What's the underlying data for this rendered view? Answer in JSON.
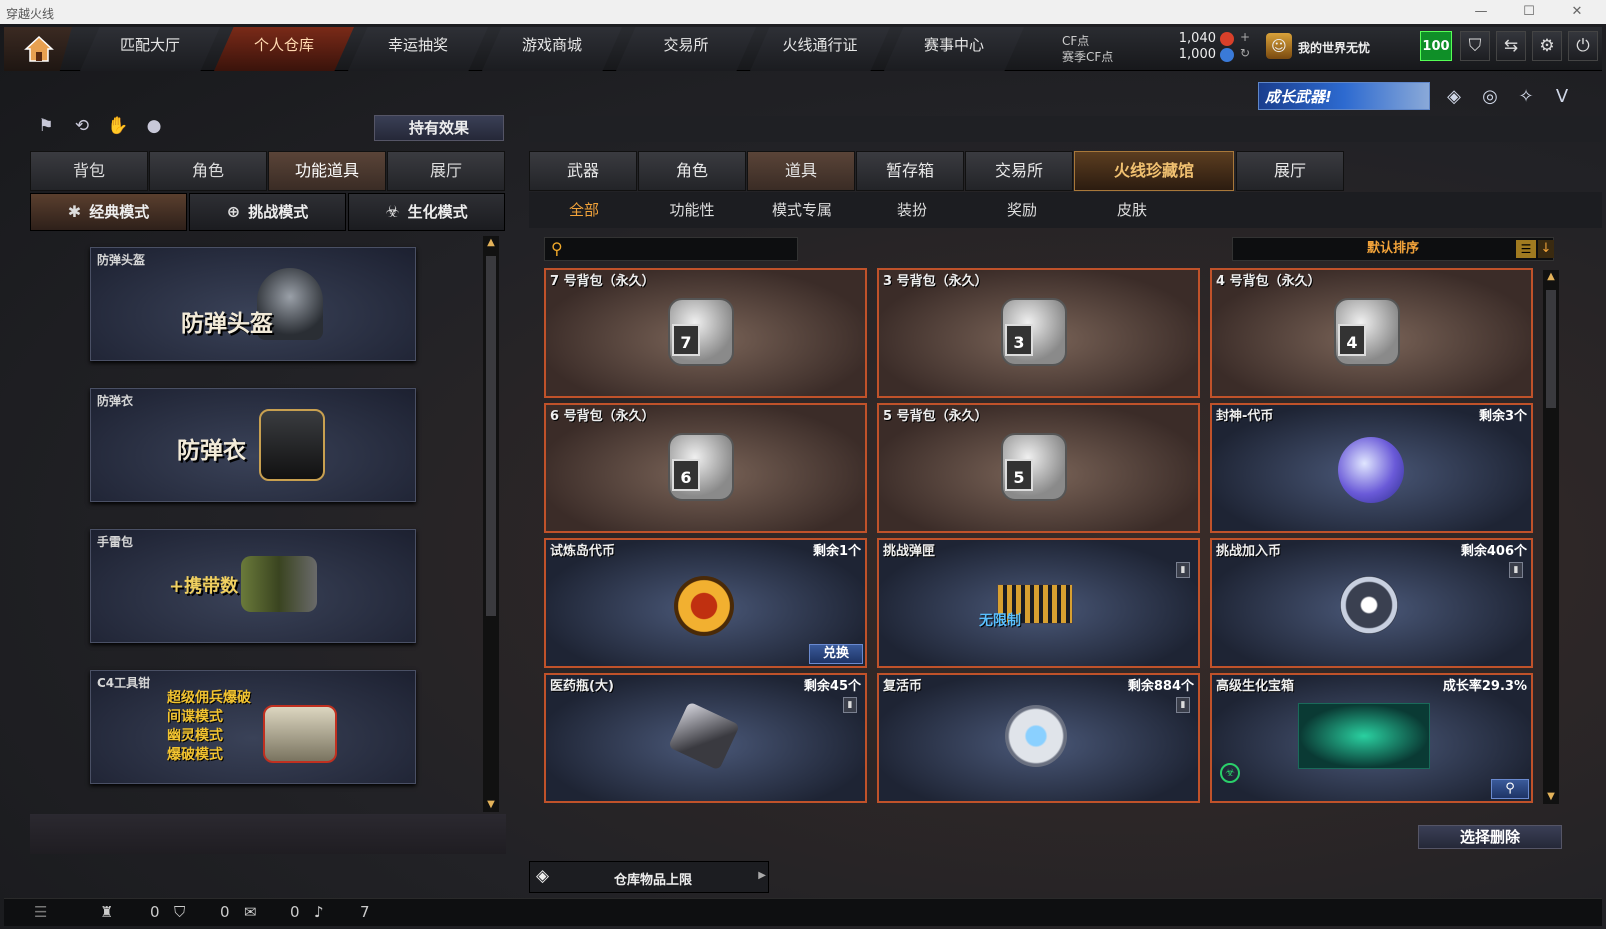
{
  "os_title": "穿越火线",
  "nav": {
    "tabs": [
      "匹配大厅",
      "个人仓库",
      "幸运抽奖",
      "游戏商城",
      "交易所",
      "火线通行证",
      "赛事中心"
    ],
    "active": 1
  },
  "currency": {
    "cf_label": "CF点",
    "cf_value": "1,040",
    "season_label": "赛季CF点",
    "season_value": "1,000"
  },
  "player": {
    "name": "我的世界无忧",
    "level": "100"
  },
  "banner": "成长武器!",
  "left": {
    "hold_effect": "持有效果",
    "tabs": [
      "背包",
      "角色",
      "功能道具",
      "展厅"
    ],
    "active_tab": 2,
    "modes": [
      "经典模式",
      "挑战模式",
      "生化模式"
    ],
    "items": [
      {
        "name": "防弹头盔",
        "big": "防弹头盔"
      },
      {
        "name": "防弹衣",
        "big": "防弹衣"
      },
      {
        "name": "手雷包",
        "big": "+携带数"
      },
      {
        "name": "C4工具钳",
        "lines": [
          "超级佣兵爆破",
          "间谍模式",
          "幽灵模式",
          "爆破模式"
        ]
      }
    ]
  },
  "right": {
    "tabs": [
      "武器",
      "角色",
      "道具",
      "暂存箱",
      "交易所",
      "火线珍藏馆",
      "展厅"
    ],
    "active_tab": 2,
    "subtabs": [
      "全部",
      "功能性",
      "模式专属",
      "装扮",
      "奖励",
      "皮肤"
    ],
    "active_subtab": 0,
    "search_placeholder": "",
    "sort_label": "默认排序",
    "cards": [
      {
        "name": "7 号背包（永久）",
        "type": "bag",
        "num": "7"
      },
      {
        "name": "3 号背包（永久）",
        "type": "bag",
        "num": "3"
      },
      {
        "name": "4 号背包（永久）",
        "type": "bag",
        "num": "4"
      },
      {
        "name": "6 号背包（永久）",
        "type": "bag",
        "num": "6"
      },
      {
        "name": "5 号背包（永久）",
        "type": "bag",
        "num": "5"
      },
      {
        "name": "封神-代币",
        "type": "blue",
        "count": "剩余3个"
      },
      {
        "name": "试炼岛代币",
        "type": "blue",
        "count": "剩余1个",
        "action": "兑换"
      },
      {
        "name": "挑战弹匣",
        "type": "blue",
        "count": "",
        "label": "无限制"
      },
      {
        "name": "挑战加入币",
        "type": "blue",
        "count": "剩余406个"
      },
      {
        "name": "医药瓶(大)",
        "type": "blue",
        "count": "剩余45个"
      },
      {
        "name": "复活币",
        "type": "blue",
        "count": "剩余884个"
      },
      {
        "name": "高级生化宝箱",
        "type": "blue",
        "count": "成长率29.3%"
      }
    ],
    "delete_selected": "选择删除",
    "capacity_label": "仓库物品上限"
  },
  "statusbar": {
    "v1": "0",
    "v2": "0",
    "v3": "0",
    "v4": "7"
  },
  "colors": {
    "accent": "#f2a33a",
    "card_border": "#c0522a",
    "level_bg": "#0f8f28"
  }
}
